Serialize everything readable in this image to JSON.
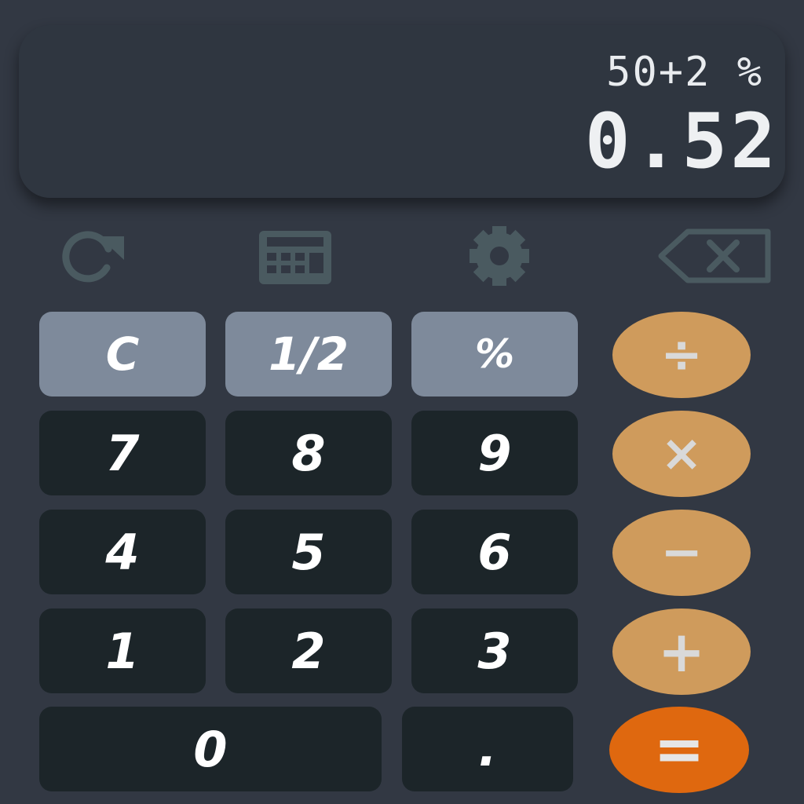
{
  "display": {
    "expression": "50+2 %",
    "result": "0.52"
  },
  "toolbar": {
    "icons": [
      "history-icon",
      "calculator-icon",
      "settings-gear-icon",
      "backspace-icon"
    ],
    "icon_color": "#4a5a60"
  },
  "keys": {
    "clear": "C",
    "half": "1/2",
    "percent": "%",
    "seven": "7",
    "eight": "8",
    "nine": "9",
    "four": "4",
    "five": "5",
    "six": "6",
    "one": "1",
    "two": "2",
    "three": "3",
    "zero": "0",
    "decimal": ".",
    "divide": "÷",
    "multiply": "×",
    "subtract": "−",
    "add": "+",
    "equals": "="
  },
  "colors": {
    "background": "#323843",
    "display_bg": "#2f3640",
    "function_key": "#7e8a9b",
    "number_key": "#1c2529",
    "operator_key": "#cf9b5c",
    "equals_key": "#df680f"
  }
}
